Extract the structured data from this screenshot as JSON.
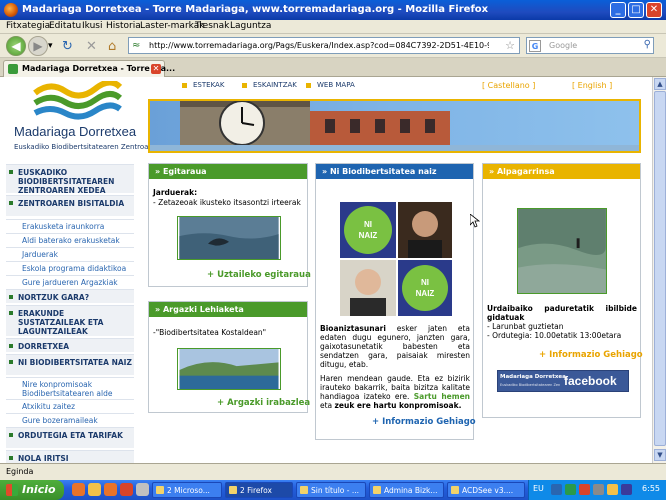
{
  "window": {
    "title": "Madariaga Dorretxea - Torre Madariaga, www.torremadariaga.org - Mozilla Firefox",
    "controls": [
      "_",
      "□",
      "✕"
    ]
  },
  "menu": [
    "Fitxategia",
    "Editatu",
    "Ikusi",
    "Historia",
    "Laster-markak",
    "Tresnak",
    "Laguntza"
  ],
  "toolbar": {
    "back": "◀",
    "forward": "▶",
    "dropdown": "▾",
    "reload": "↻",
    "stop": "✕",
    "home": "⌂",
    "url": "http://www.torremadariaga.org/Pags/Euskera/Index.asp?cod=084C7392-2D51-4E10-990F-F56BC6794A18&",
    "search_placeholder": "Google"
  },
  "tab": {
    "title": "Madariaga Dorretxea - Torre Ma...",
    "close": "✕"
  },
  "page": {
    "logo_name": "Madariaga Dorretxea",
    "logo_sub": "Euskadiko Biodibertsitatearen Zentroa",
    "topnav": [
      "ESTEKAK",
      "ESKAINTZAK",
      "WEB MAPA"
    ],
    "lang_es": "[ Castellano ]",
    "lang_en": "[ English ]",
    "sidebar": [
      {
        "label": "EUSKADIKO BIODIBERTSITATEAREN ZENTROAREN XEDEA",
        "type": "main"
      },
      {
        "label": "ZENTROAREN BISITALDIA",
        "type": "main"
      },
      {
        "label": "Erakusketa iraunkorra",
        "type": "sub"
      },
      {
        "label": "Aldi baterako erakusketak",
        "type": "sub"
      },
      {
        "label": "Jarduerak",
        "type": "sub"
      },
      {
        "label": "Eskola programa didaktikoa",
        "type": "sub"
      },
      {
        "label": "Gure jardueren Argazkiak",
        "type": "sub"
      },
      {
        "label": "NORTZUK GARA?",
        "type": "main"
      },
      {
        "label": "ERAKUNDE SUSTATZAILEAK ETA LAGUNTZAILEAK",
        "type": "main"
      },
      {
        "label": "DORRETXEA",
        "type": "main"
      },
      {
        "label": "NI BIODIBERTSITATEA NAIZ",
        "type": "main"
      },
      {
        "label": "Nire konpromisoak Biodibertsitatearen alde",
        "type": "sub"
      },
      {
        "label": "Atxikitu zaitez",
        "type": "sub"
      },
      {
        "label": "Gure bozeramaileak",
        "type": "sub"
      },
      {
        "label": "ORDUTEGIA ETA TARIFAK",
        "type": "main"
      },
      {
        "label": "NOLA IRITSI",
        "type": "main"
      }
    ],
    "egitaraua": {
      "head": "Egitaraua",
      "title": "Jarduerak:",
      "text": "- Zetazeoak ikusteko itsasontzi irteerak",
      "link": "+ Uztaileko egitaraua"
    },
    "argazki": {
      "head": "Argazki Lehiaketa",
      "text": "-\"Biodibertsitatea Kostaldean\"",
      "link": "+ Argazki irabazlea"
    },
    "ni": {
      "head": "Ni Biodibertsitatea naiz",
      "badge": "NI BIODIBERTSITATEA NAIZ",
      "bold1": "Bioaniztasunari",
      "text1": " esker jaten eta edaten dugu egunero, janzten gara, gaixotasunetatik babesten eta sendatzen gara, paisaiak miresten ditugu, etab.",
      "text2a": "Haren mendean gaude. Eta ez bizirik irauteko bakarrik, baita bizitza kalitate handiagoa izateko ere.",
      "link_inline": "Sartu hemen",
      "text2b": " eta ",
      "bold2": "zeuk ere hartu konpromisoak.",
      "link": "+ Informazio Gehiago"
    },
    "alpagarrinsa": {
      "head": "Alpagarrinsa",
      "title": "Urdaibaiko paduretatik ibilbide gidatuak",
      "line1": "- Larunbat guztietan",
      "line2": "- Ordutegia: 10.00etatik 13:00etara",
      "link": "+ Informazio Gehiago",
      "fb_small": "Madariaga Dorretxea",
      "fb_sub": "Euskadiko Biodibertsitatearen Zentroa",
      "fb": "facebook"
    }
  },
  "status": "Eginda",
  "taskbar": {
    "start": "Inicio",
    "tasks": [
      "2 Microso...",
      "2 Firefox",
      "Sin título - ...",
      "Admina Bizk...",
      "ACDSee v3...."
    ],
    "lang": "EU",
    "clock": "6:55"
  },
  "colors": {
    "green": "#4a9a2a",
    "yellow": "#e9b400",
    "blue": "#1e64b0",
    "navy": "#1b3a6b"
  }
}
